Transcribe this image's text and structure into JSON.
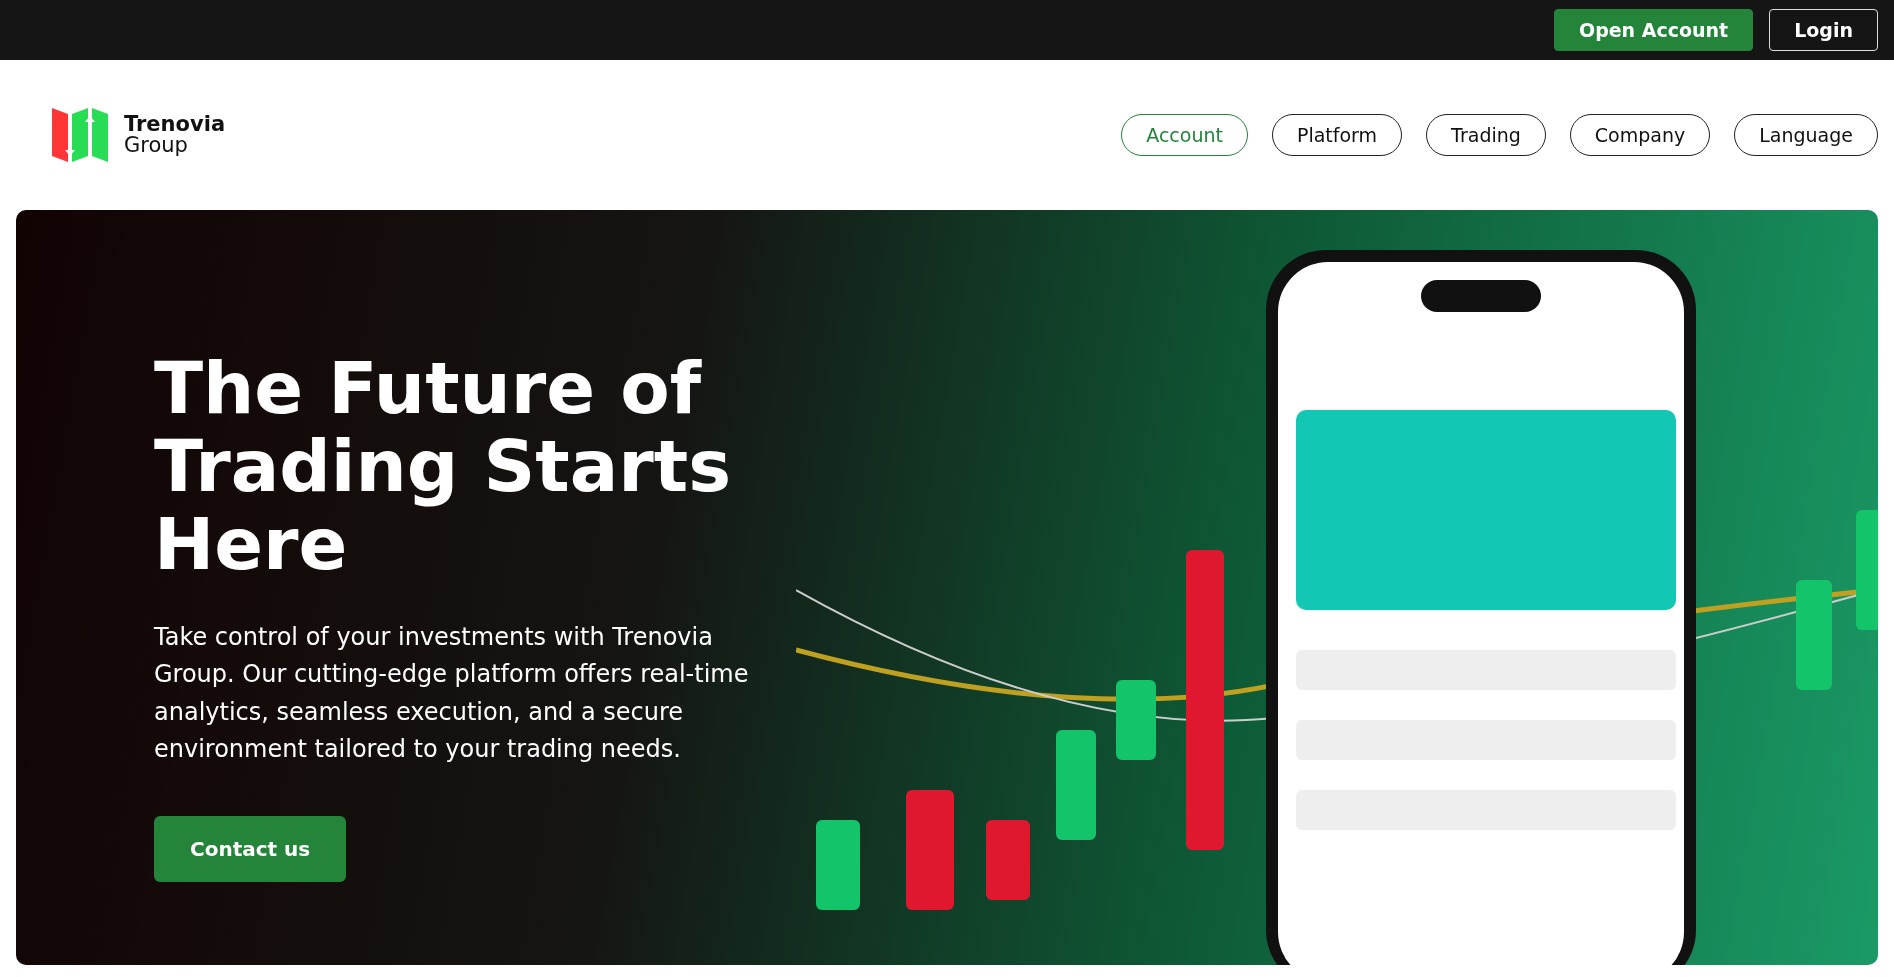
{
  "top_bar": {
    "buttons": [
      {
        "label": "Open Account",
        "kind": "primary"
      },
      {
        "label": "Login",
        "kind": "outline"
      }
    ]
  },
  "brand": {
    "name": "Trenovia",
    "subtitle": "Group"
  },
  "nav": [
    {
      "label": "Account",
      "selected": true
    },
    {
      "label": "Platform",
      "selected": false
    },
    {
      "label": "Trading",
      "selected": false
    },
    {
      "label": "Company",
      "selected": false
    },
    {
      "label": "Language",
      "selected": false
    }
  ],
  "hero": {
    "title_lines": [
      "The Future of",
      "Trading Starts Here"
    ],
    "text": "Take control of your investments with Trenovia Group. Our cutting-edge platform offers real-time analytics, seamless execution, and a secure environment tailored to your trading needs.",
    "button": "Contact us"
  }
}
